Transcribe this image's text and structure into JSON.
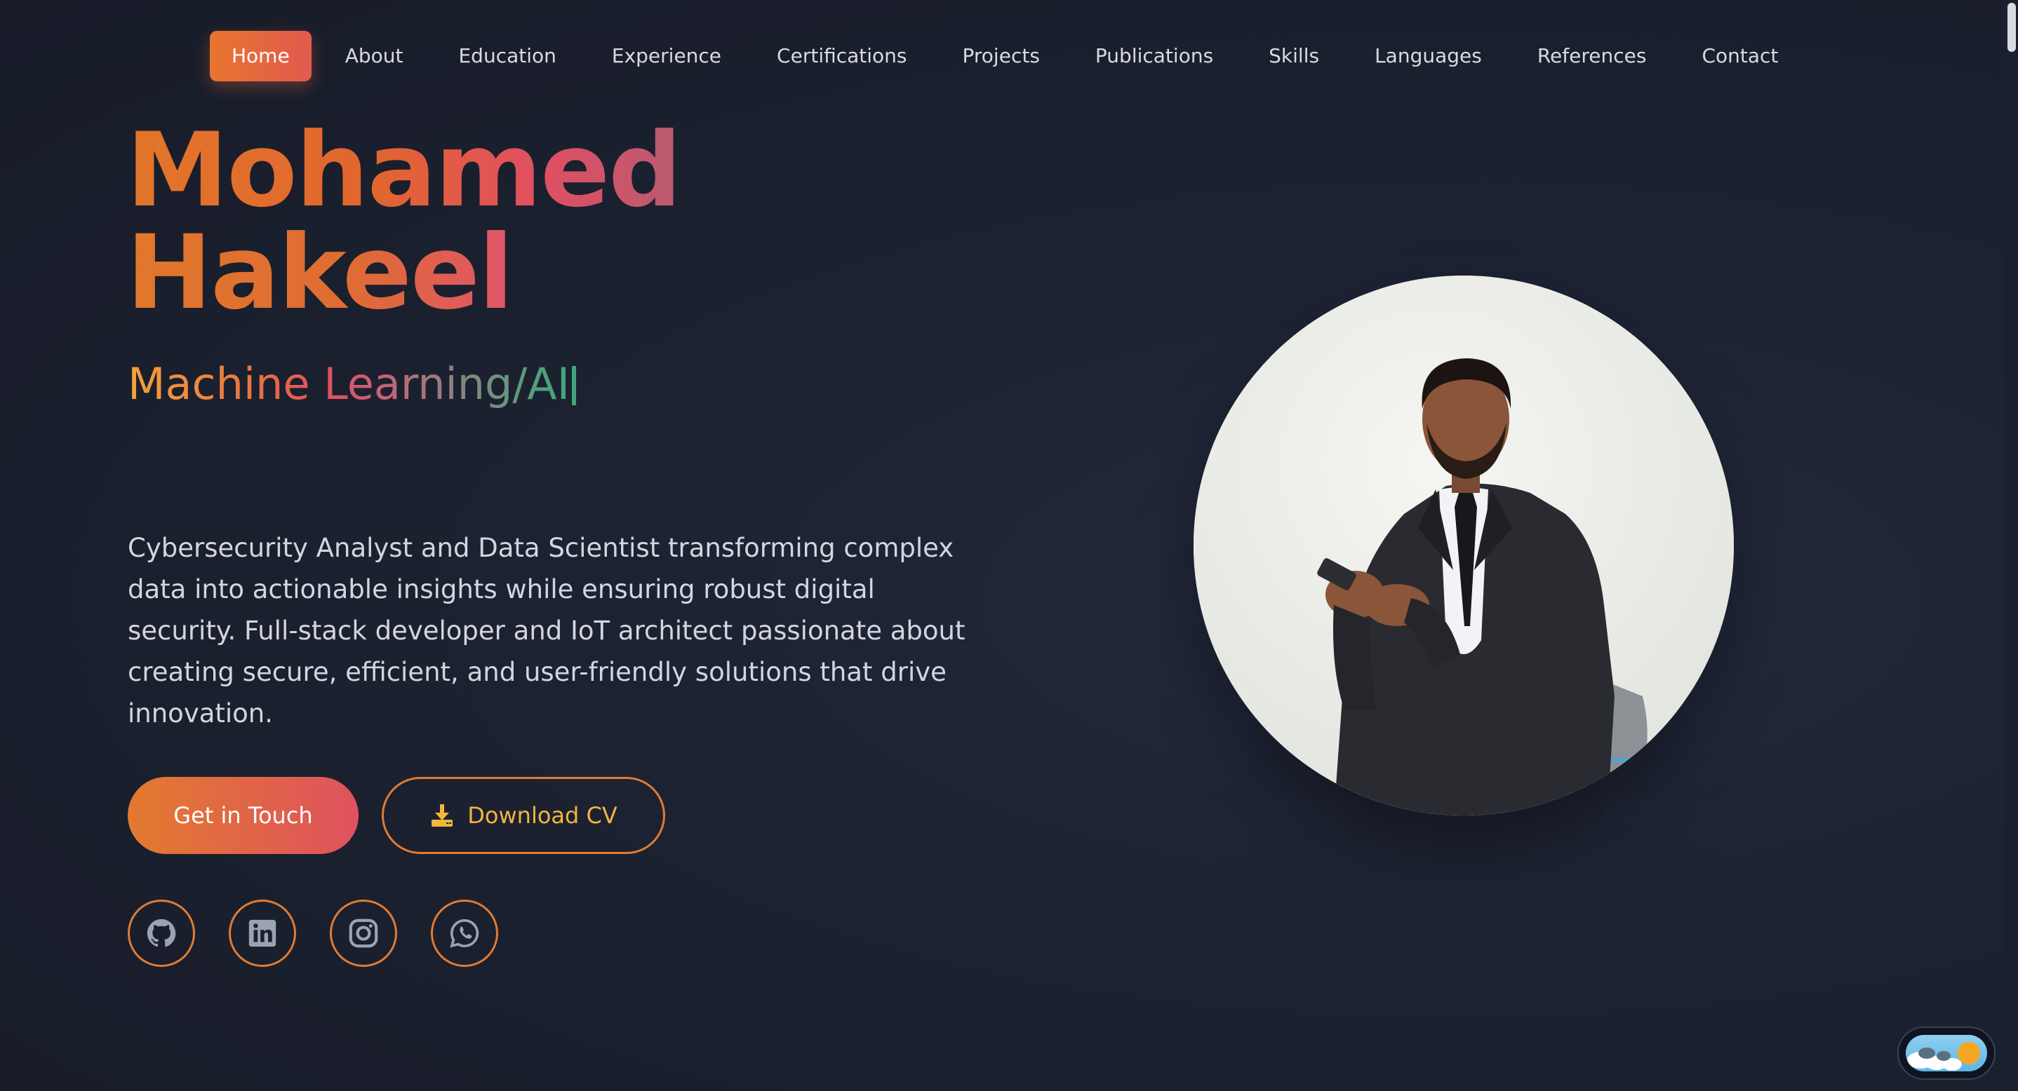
{
  "nav": {
    "items": [
      {
        "label": "Home",
        "active": true
      },
      {
        "label": "About",
        "active": false
      },
      {
        "label": "Education",
        "active": false
      },
      {
        "label": "Experience",
        "active": false
      },
      {
        "label": "Certifications",
        "active": false
      },
      {
        "label": "Projects",
        "active": false
      },
      {
        "label": "Publications",
        "active": false
      },
      {
        "label": "Skills",
        "active": false
      },
      {
        "label": "Languages",
        "active": false
      },
      {
        "label": "References",
        "active": false
      },
      {
        "label": "Contact",
        "active": false
      }
    ]
  },
  "hero": {
    "first_name": "Mohamed",
    "last_name": "Hakeel",
    "role": "Machine Learning/AI",
    "description": "Cybersecurity Analyst and Data Scientist transforming complex data into actionable insights while ensuring robust digital security. Full-stack developer and IoT architect passionate about creating secure, efficient, and user-friendly solutions that drive innovation.",
    "primary_button": "Get in Touch",
    "secondary_button": "Download CV"
  },
  "socials": [
    {
      "icon": "github-icon"
    },
    {
      "icon": "linkedin-icon"
    },
    {
      "icon": "instagram-icon"
    },
    {
      "icon": "whatsapp-icon"
    }
  ],
  "colors": {
    "accent_orange": "#e27a2f",
    "accent_pink": "#e0525e",
    "accent_green": "#3fa77a",
    "accent_gold": "#f2b53d",
    "background": "#1c2131",
    "icon_gray": "#9aa3b2"
  },
  "theme_toggle": {
    "mode": "light"
  }
}
